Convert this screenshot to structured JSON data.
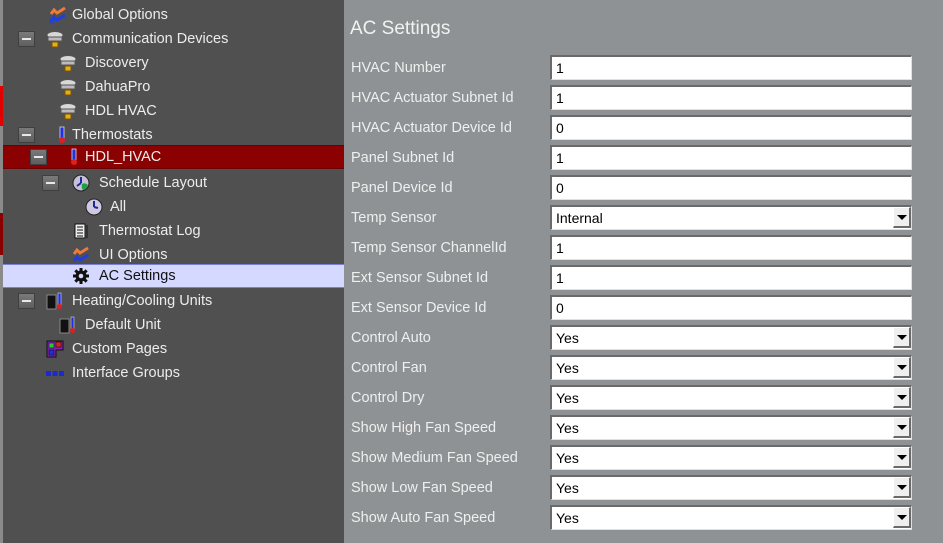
{
  "tree": {
    "nodes": [
      {
        "label": "Global Options",
        "icon": "options-icon"
      },
      {
        "label": "Communication Devices",
        "icon": "network-device-icon"
      },
      {
        "label": "Discovery",
        "icon": "network-device-icon"
      },
      {
        "label": "DahuaPro",
        "icon": "network-device-icon"
      },
      {
        "label": "HDL HVAC",
        "icon": "network-device-icon"
      },
      {
        "label": "Thermostats",
        "icon": "thermometer-icon"
      },
      {
        "label": "HDL_HVAC",
        "icon": "thermometer-icon"
      },
      {
        "label": "Schedule Layout",
        "icon": "schedule-globe-icon"
      },
      {
        "label": "All",
        "icon": "clock-icon"
      },
      {
        "label": "Thermostat Log",
        "icon": "log-icon"
      },
      {
        "label": "UI Options",
        "icon": "options-icon"
      },
      {
        "label": "AC Settings",
        "icon": "gear-icon"
      },
      {
        "label": "Heating/Cooling Units",
        "icon": "hvac-unit-icon"
      },
      {
        "label": "Default Unit",
        "icon": "hvac-unit-icon"
      },
      {
        "label": "Custom Pages",
        "icon": "custom-pages-icon"
      },
      {
        "label": "Interface Groups",
        "icon": "interface-groups-icon"
      }
    ]
  },
  "panel": {
    "title": "AC Settings",
    "fields": [
      {
        "label": "HVAC Number",
        "type": "text",
        "value": "1"
      },
      {
        "label": "HVAC Actuator Subnet Id",
        "type": "text",
        "value": "1"
      },
      {
        "label": "HVAC Actuator Device Id",
        "type": "text",
        "value": "0"
      },
      {
        "label": "Panel Subnet Id",
        "type": "text",
        "value": "1"
      },
      {
        "label": "Panel Device Id",
        "type": "text",
        "value": "0"
      },
      {
        "label": "Temp Sensor",
        "type": "select",
        "value": "Internal"
      },
      {
        "label": "Temp Sensor ChannelId",
        "type": "text",
        "value": "1"
      },
      {
        "label": "Ext Sensor Subnet Id",
        "type": "text",
        "value": "1"
      },
      {
        "label": "Ext Sensor Device Id",
        "type": "text",
        "value": "0"
      },
      {
        "label": "Control Auto",
        "type": "select",
        "value": "Yes"
      },
      {
        "label": "Control Fan",
        "type": "select",
        "value": "Yes"
      },
      {
        "label": "Control Dry",
        "type": "select",
        "value": "Yes"
      },
      {
        "label": "Show High Fan Speed",
        "type": "select",
        "value": "Yes"
      },
      {
        "label": "Show Medium Fan Speed",
        "type": "select",
        "value": "Yes"
      },
      {
        "label": "Show Low Fan Speed",
        "type": "select",
        "value": "Yes"
      },
      {
        "label": "Show Auto Fan Speed",
        "type": "select",
        "value": "Yes"
      }
    ]
  },
  "colors": {
    "tree_bg": "#505050",
    "panel_bg": "#8e9294",
    "selected_parent": "#8b0000",
    "selected_item": "#d5d8ff"
  }
}
